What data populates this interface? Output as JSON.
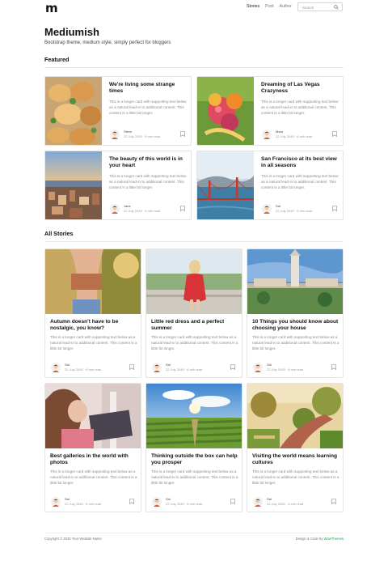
{
  "navbar": {
    "logo": "m",
    "links": [
      "Stories",
      "Post",
      "Author"
    ],
    "search_placeholder": "Search"
  },
  "header": {
    "title": "Mediumish",
    "tagline": "Bootstrap theme, medium style, simply perfect for bloggers"
  },
  "featured": {
    "heading": "Featured",
    "cards": [
      {
        "title": "We're living some strange times",
        "text": "This is a longer card with supporting text below as a natural lead-in to additional content. This content is a little bit longer.",
        "author": "Steve",
        "meta": "22 July 2045 · 6 min read",
        "image": "food"
      },
      {
        "title": "Dreaming of Las Vegas Crazyness",
        "text": "This is a longer card with supporting text below as a natural lead-in to additional content. This content is a little bit longer.",
        "author": "Mara",
        "meta": "22 July 2045 · 6 min read",
        "image": "fruit"
      },
      {
        "title": "The beauty of this world is in your heart",
        "text": "This is a longer card with supporting text below as a natural lead-in to additional content. This content is a little bit longer.",
        "author": "Jane",
        "meta": "22 July 2045 · 6 min read",
        "image": "city"
      },
      {
        "title": "San Francisco at its best view in all seasons",
        "text": "This is a longer card with supporting text below as a natural lead-in to additional content. This content is a little bit longer.",
        "author": "Sal",
        "meta": "22 July 2045 · 6 min read",
        "image": "bridge"
      }
    ]
  },
  "stories": {
    "heading": "All Stories",
    "cards": [
      {
        "title": "Autumn doesn't have to be nostalgic, you know?",
        "text": "This is a longer card with supporting text below as a natural lead-in to additional content. This content is a little bit longer.",
        "author": "Sal",
        "meta": "22 July 2045 · 6 min read",
        "image": "autumn"
      },
      {
        "title": "Little red dress and a perfect summer",
        "text": "This is a longer card with supporting text below as a natural lead-in to additional content. This content is a little bit longer.",
        "author": "Sal",
        "meta": "22 July 2045 · 6 min read",
        "image": "dress"
      },
      {
        "title": "10 Things you should know about choosing your house",
        "text": "This is a longer card with supporting text below as a natural lead-in to additional content. This content is a little bit longer.",
        "author": "Sal",
        "meta": "22 July 2045 · 6 min read",
        "image": "tower"
      },
      {
        "title": "Best galleries in the world with photos",
        "text": "This is a longer card with supporting text below as a natural lead-in to additional content. This content is a little bit longer.",
        "author": "Sal",
        "meta": "22 July 2045 · 6 min read",
        "image": "laptop"
      },
      {
        "title": "Thinking outside the box can help you prosper",
        "text": "This is a longer card with supporting text below as a natural lead-in to additional content. This content is a little bit longer.",
        "author": "Sal",
        "meta": "22 July 2045 · 6 min read",
        "image": "vineyard"
      },
      {
        "title": "Visiting the world means learning cultures",
        "text": "This is a longer card with supporting text below as a natural lead-in to additional content. This content is a little bit longer.",
        "author": "Sal",
        "meta": "22 July 2045 · 6 min read",
        "image": "road"
      }
    ]
  },
  "footer": {
    "left": "Copyright © 2045 Your Website Name",
    "right_prefix": "Design & Code by",
    "right_brand": "WowThemes"
  },
  "colors": {
    "accent": "#1ea055",
    "text": "#111111",
    "muted": "#8a8a8a",
    "border": "#e4e4e4"
  }
}
